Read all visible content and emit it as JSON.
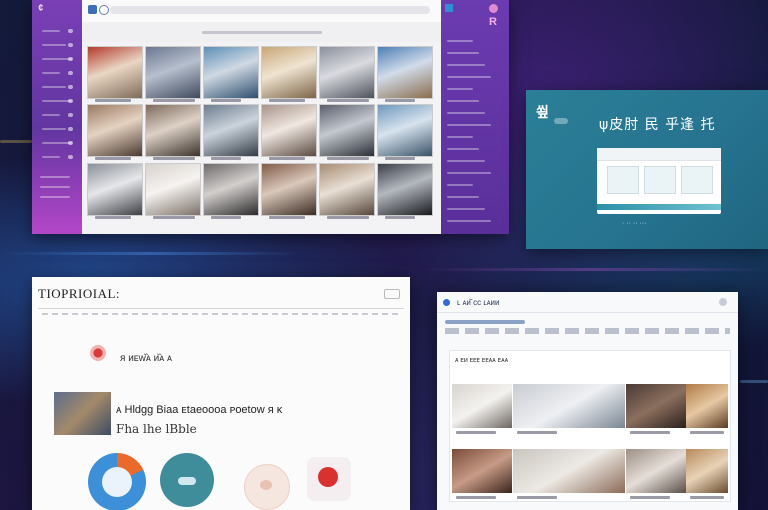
{
  "window_top_left": {
    "sidebar_top_glyph": "¢",
    "right_panel_glyph": "R"
  },
  "window_top_right": {
    "logo_glyph": "쑆",
    "title": "ψ皮肘 民 乎逢 托",
    "card_caption": "· ·· ·· ···"
  },
  "window_bottom_left": {
    "heading": "TIOPRIOIAL:",
    "row1_text": "ᴙ ᴎᴇᴡ᷈ᴀ  ᴎ᷈ᴀ  ᴀ",
    "row2_text": "ᴀ Hldgg Biaa ᴇtaeoooa ᴘoetow ᴙ ᴋ",
    "row3_text": "Fha lhe lBble"
  },
  "window_bottom_right": {
    "header_text": "ʟ  ᴀᴎ᷈ ᴄᴄ ʟᴀᴎᴎ",
    "section_label": "ᴀ ᴇᴎ ᴇᴇᴇ ᴇᴇᴀᴀ ᴇᴀᴀ"
  },
  "colors": {
    "sidebar_purple": "#7a3fb5",
    "panel_teal": "#2b7f97",
    "circle_blue": "#3d8fd8",
    "circle_teal": "#3f8c9a"
  }
}
